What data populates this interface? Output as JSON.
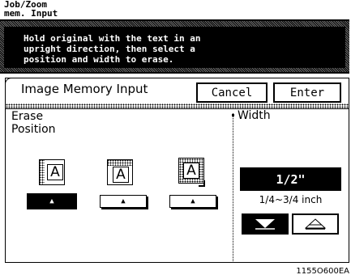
{
  "header": {
    "title_line1": "Job/Zoom",
    "title_line2": "mem. Input"
  },
  "instruction": {
    "text": "Hold original with the text in an\nupright direction, then select a\nposition and width to erase."
  },
  "panel": {
    "title": "Image Memory Input",
    "cancel_label": "Cancel",
    "enter_label": "Enter"
  },
  "erase": {
    "label_line1": "Erase",
    "label_line2": "Position",
    "positions": [
      {
        "letter": "A",
        "arrow": "▲",
        "selected": true
      },
      {
        "letter": "A",
        "arrow": "▲",
        "selected": false
      },
      {
        "letter": "A",
        "arrow": "▲",
        "selected": false
      }
    ]
  },
  "width": {
    "label": "Width",
    "value": "1/2\"",
    "range": "1/4~3/4 inch",
    "decrease_icon": "down-triangle-icon",
    "increase_icon": "up-triangle-icon"
  },
  "footer": {
    "code": "1155O600EA"
  }
}
